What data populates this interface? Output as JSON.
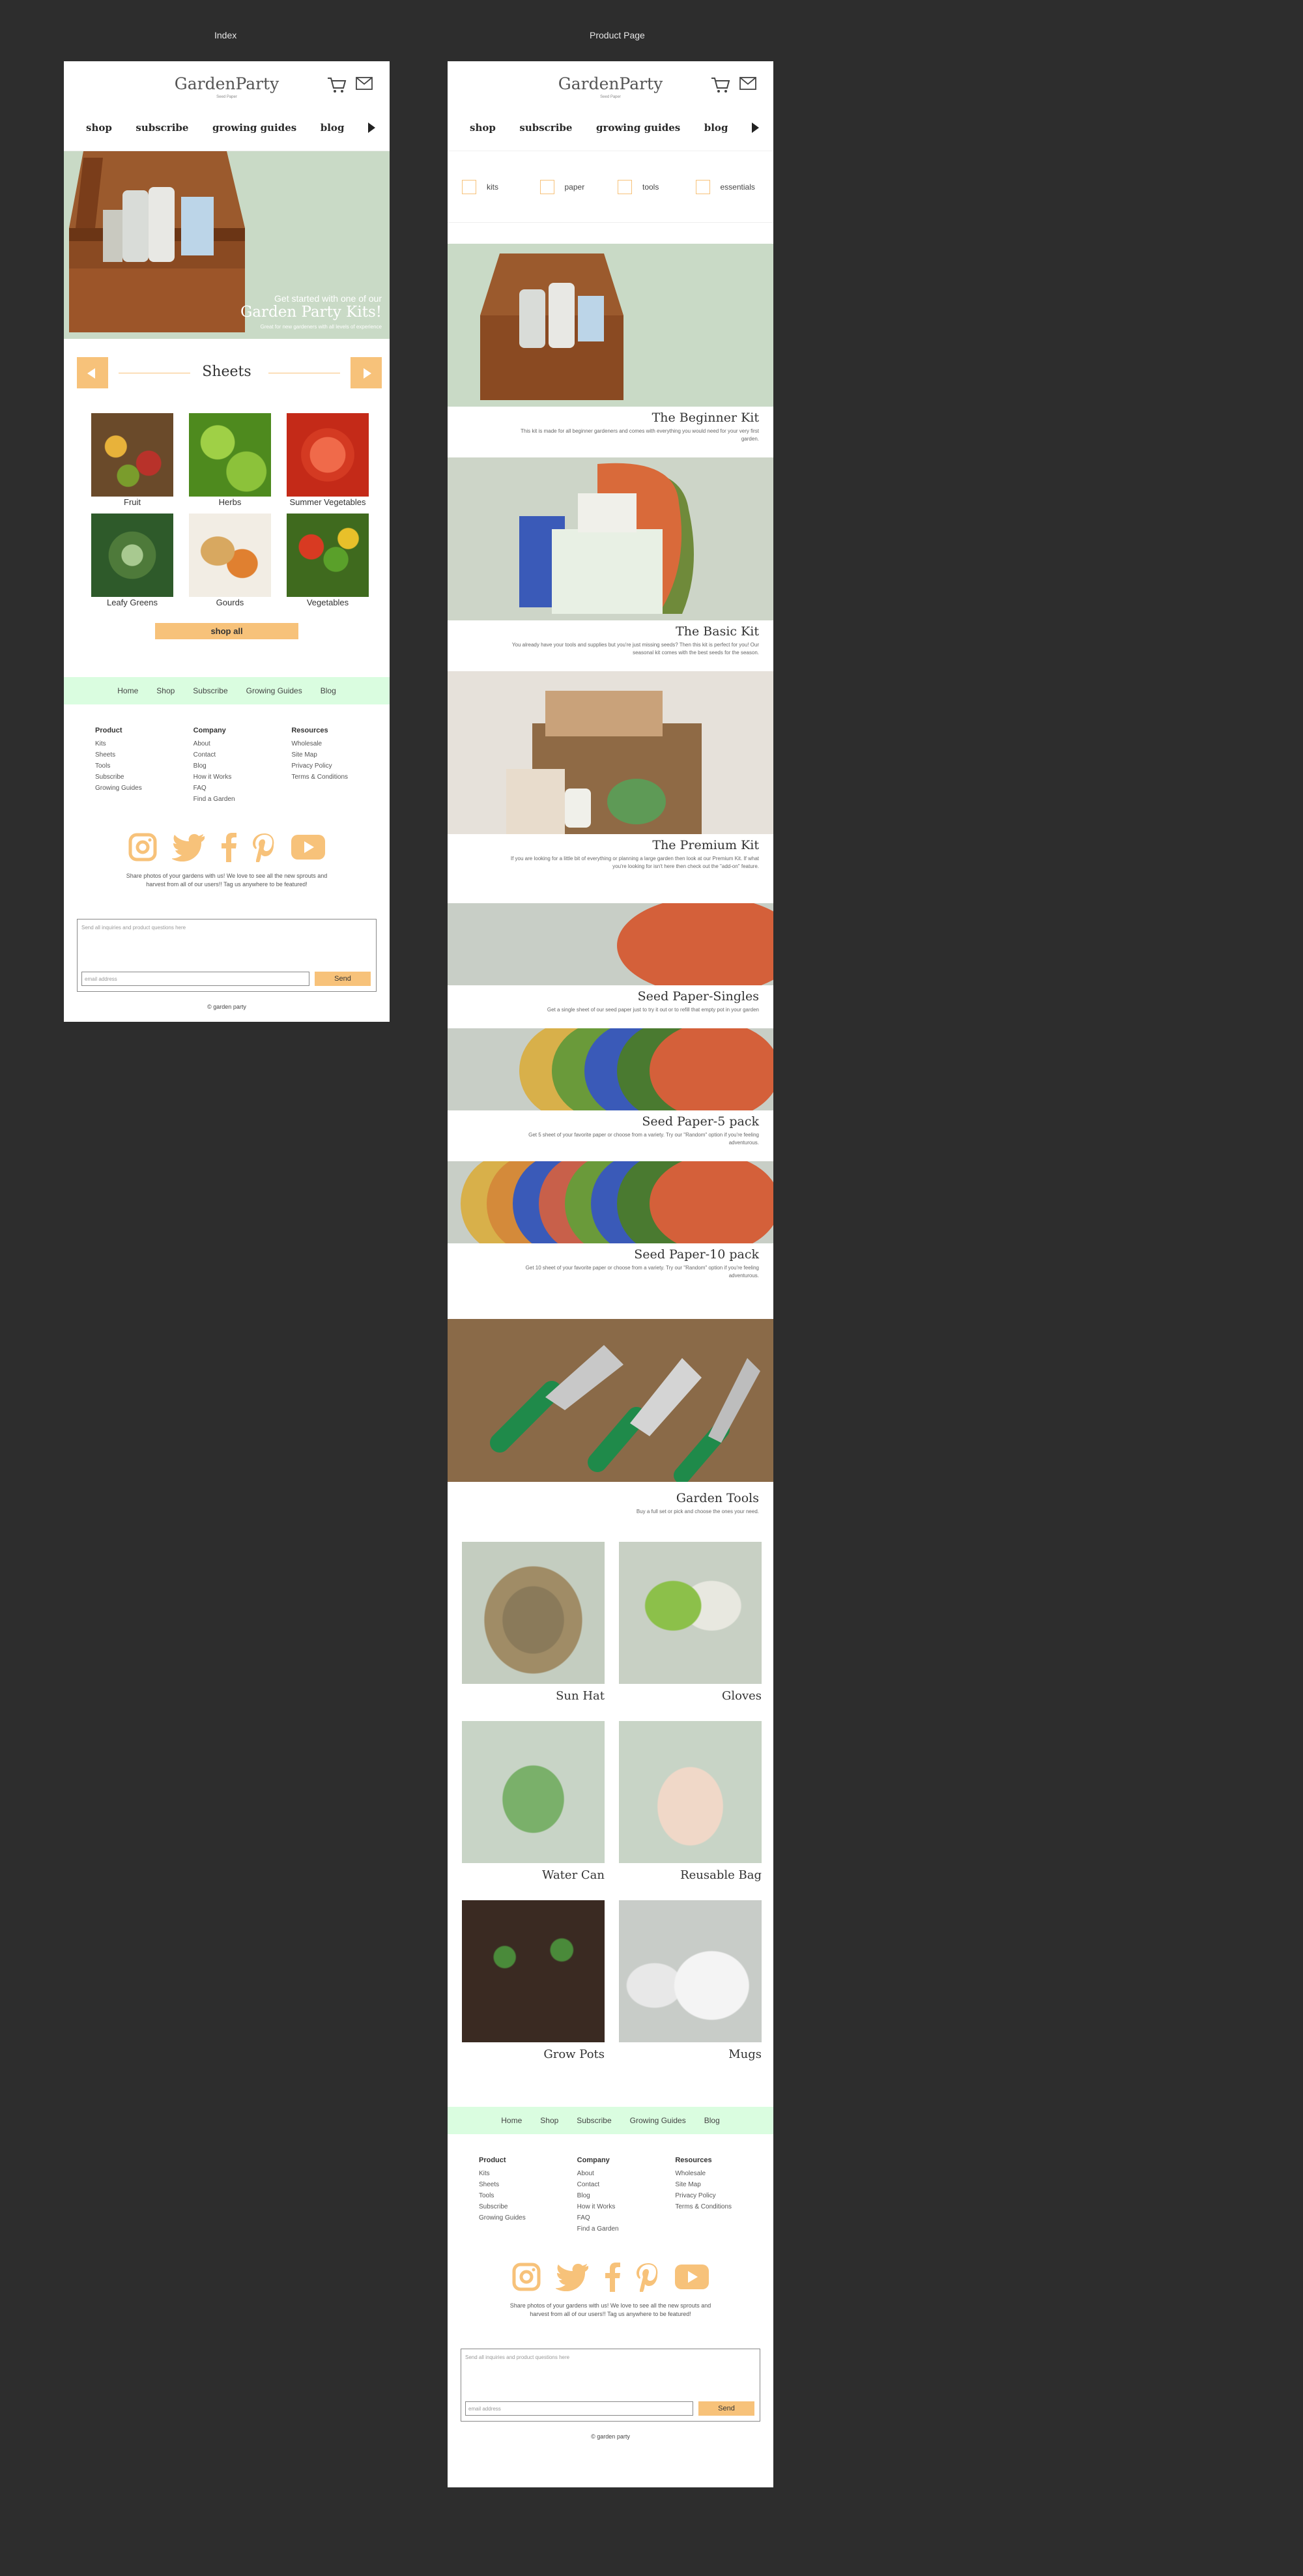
{
  "artboards": {
    "index_label": "Index",
    "product_label": "Product Page"
  },
  "header": {
    "brand": "GardenParty",
    "tagline": "Seed Paper"
  },
  "nav": {
    "items": [
      "shop",
      "subscribe",
      "growing guides",
      "blog"
    ]
  },
  "index": {
    "hero": {
      "line1": "Get started with one of our",
      "line2": "Garden Party Kits!",
      "line3": "Great for new gardeners with all levels of experience"
    },
    "sheets": {
      "title": "Sheets",
      "items": [
        "Fruit",
        "Herbs",
        "Summer Vegetables",
        "Leafy Greens",
        "Gourds",
        "Vegetables"
      ],
      "shop_all": "shop all"
    }
  },
  "footer": {
    "nav": [
      "Home",
      "Shop",
      "Subscribe",
      "Growing Guides",
      "Blog"
    ],
    "columns": [
      {
        "heading": "Product",
        "links": [
          "Kits",
          "Sheets",
          "Tools",
          "Subscribe",
          "Growing Guides"
        ]
      },
      {
        "heading": "Company",
        "links": [
          "About",
          "Contact",
          "Blog",
          "How it Works",
          "FAQ",
          "Find a Garden"
        ]
      },
      {
        "heading": "Resources",
        "links": [
          "Wholesale",
          "Site Map",
          "Privacy Policy",
          "Terms & Conditions"
        ]
      }
    ],
    "social_icons": [
      "instagram-icon",
      "twitter-icon",
      "facebook-icon",
      "pinterest-icon",
      "youtube-icon"
    ],
    "social_text": "Share photos of your gardens with us! We love to see all the new sprouts and harvest from all of our users!! Tag us anywhere to be featured!",
    "contact_placeholder": "Send all inquiries and product questions here",
    "email_placeholder": "email address",
    "send_label": "Send",
    "copyright": "© garden party"
  },
  "product_page": {
    "filters": [
      "kits",
      "paper",
      "tools",
      "essentials"
    ],
    "products": [
      {
        "title": "The Beginner Kit",
        "desc": "This kit is made for all beginner gardeners and comes with everything you would need for your very first garden."
      },
      {
        "title": "The Basic Kit",
        "desc": "You already have your tools and supplies but you're just missing seeds? Then this kit is perfect for you! Our seasonal kit comes with the best seeds for the season."
      },
      {
        "title": "The Premium Kit",
        "desc": "If you are looking for a little bit of everything or planning a large garden then look at our Premium Kit. If what you're looking for isn't here then check out the \"add-on\" feature."
      },
      {
        "title": "Seed Paper-Singles",
        "desc": "Get a single sheet of our seed paper just to try it out or to refill that empty pot in your garden"
      },
      {
        "title": "Seed Paper-5 pack",
        "desc": "Get 5 sheet of your favorite paper or choose from a variety. Try our \"Random\" option if you're feeling adventurous."
      },
      {
        "title": "Seed Paper-10 pack",
        "desc": "Get 10 sheet of your favorite paper or choose from a variety. Try our \"Random\" option if you're feeling adventurous."
      }
    ],
    "tools_section": {
      "title": "Garden Tools",
      "desc": "Buy a full set or pick and choose the ones your need."
    },
    "tools": [
      "Sun Hat",
      "Gloves",
      "Water Can",
      "Reusable Bag",
      "Grow Pots",
      "Mugs"
    ]
  },
  "colors": {
    "accent": "#f7c27a",
    "footer_nav_bg": "#dafde0",
    "hero_bg": "#c9dac6",
    "canvas": "#2d2d2d"
  }
}
